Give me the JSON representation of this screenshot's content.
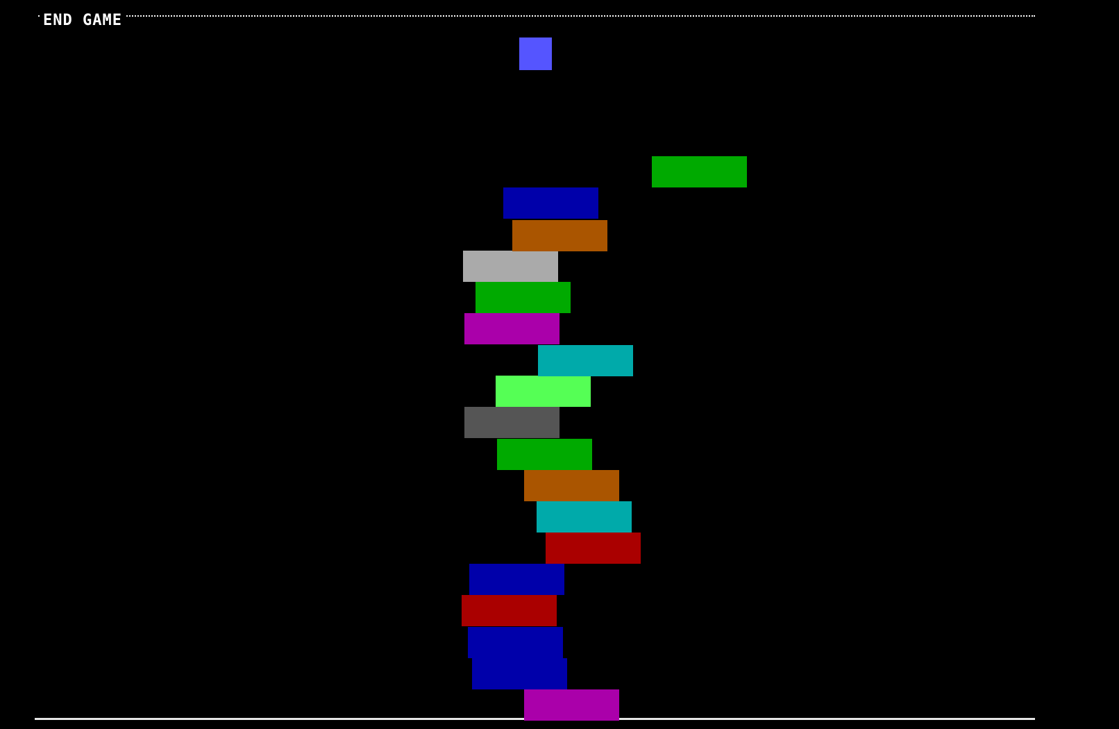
{
  "hud": {
    "end_game_label": "END GAME"
  },
  "colors": {
    "background": "#000000",
    "active_piece": "#5555ff",
    "ground": "#e6e6e6"
  },
  "active_piece": {
    "name": "active-piece",
    "color": "#5555ff"
  },
  "swinging_block": {
    "name": "swinging-block",
    "color": "#00aa00"
  },
  "stack": [
    {
      "name": "stack-block-1",
      "color": "#aa00aa"
    },
    {
      "name": "stack-block-2",
      "color": "#0000aa"
    },
    {
      "name": "stack-block-3",
      "color": "#0000aa"
    },
    {
      "name": "stack-block-4",
      "color": "#aa0000"
    },
    {
      "name": "stack-block-5",
      "color": "#0000aa"
    },
    {
      "name": "stack-block-6",
      "color": "#aa0000"
    },
    {
      "name": "stack-block-7",
      "color": "#00aaaa"
    },
    {
      "name": "stack-block-8",
      "color": "#aa5500"
    },
    {
      "name": "stack-block-9",
      "color": "#00aa00"
    },
    {
      "name": "stack-block-10",
      "color": "#555555"
    },
    {
      "name": "stack-block-11",
      "color": "#55ff55"
    },
    {
      "name": "stack-block-12",
      "color": "#00aaaa"
    },
    {
      "name": "stack-block-13",
      "color": "#aa00aa"
    },
    {
      "name": "stack-block-14",
      "color": "#00aa00"
    },
    {
      "name": "stack-block-15",
      "color": "#aaaaaa"
    },
    {
      "name": "stack-block-16",
      "color": "#aa5500"
    },
    {
      "name": "stack-block-17",
      "color": "#0000aa"
    }
  ]
}
